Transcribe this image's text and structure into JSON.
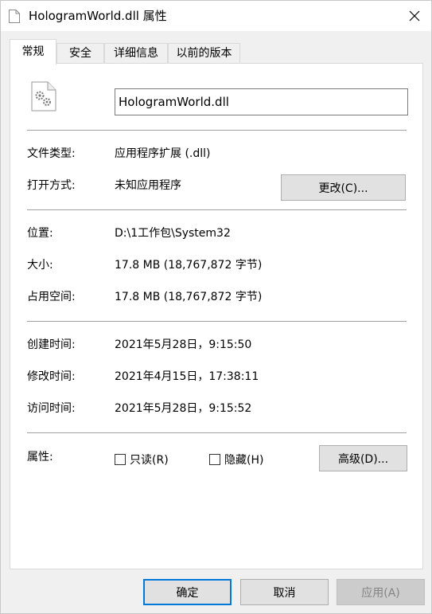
{
  "window": {
    "title": "HologramWorld.dll 属性",
    "close_glyph": "✕"
  },
  "tabs": [
    {
      "label": "常规",
      "active": true
    },
    {
      "label": "安全",
      "active": false
    },
    {
      "label": "详细信息",
      "active": false
    },
    {
      "label": "以前的版本",
      "active": false
    }
  ],
  "general": {
    "filename": "HologramWorld.dll",
    "file_type_label": "文件类型:",
    "file_type_value": "应用程序扩展 (.dll)",
    "opens_with_label": "打开方式:",
    "opens_with_value": "未知应用程序",
    "change_button": "更改(C)...",
    "location_label": "位置:",
    "location_value": "D:\\1工作包\\System32",
    "size_label": "大小:",
    "size_value": "17.8 MB (18,767,872 字节)",
    "size_on_disk_label": "占用空间:",
    "size_on_disk_value": "17.8 MB (18,767,872 字节)",
    "created_label": "创建时间:",
    "created_value": "2021年5月28日，9:15:50",
    "modified_label": "修改时间:",
    "modified_value": "2021年4月15日，17:38:11",
    "accessed_label": "访问时间:",
    "accessed_value": "2021年5月28日，9:15:52",
    "attributes_label": "属性:",
    "readonly_label": "只读(R)",
    "readonly_checked": false,
    "hidden_label": "隐藏(H)",
    "hidden_checked": false,
    "advanced_button": "高级(D)..."
  },
  "footer": {
    "ok": "确定",
    "cancel": "取消",
    "apply": "应用(A)"
  },
  "colors": {
    "accent": "#0078d7",
    "panel_bg": "#ffffff",
    "window_bg": "#f0f0f0"
  }
}
